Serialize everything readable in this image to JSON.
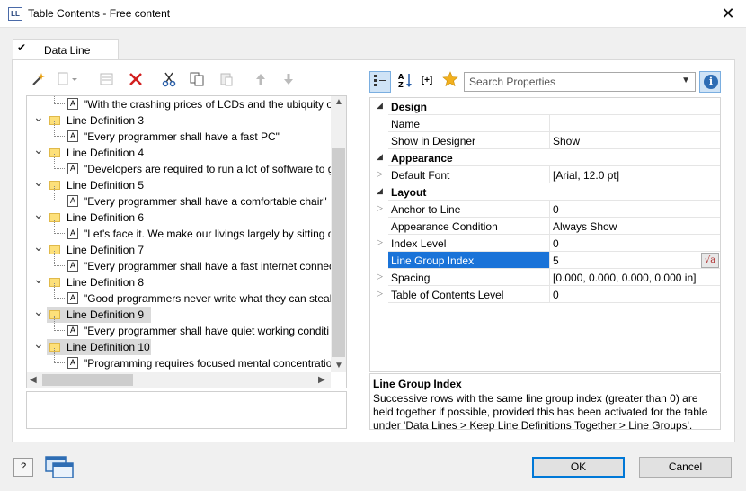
{
  "window": {
    "icon_label": "LL",
    "title": "Table Contents - Free content",
    "close_glyph": "✕"
  },
  "tabs": [
    {
      "label": "Data Line",
      "check": "✔"
    }
  ],
  "left_toolbar": {
    "items": [
      {
        "icon": "magic-wand-icon",
        "enabled": true
      },
      {
        "icon": "new-item-icon",
        "enabled": false
      },
      {
        "icon": "properties-icon",
        "enabled": false
      },
      {
        "icon": "delete-icon",
        "enabled": true
      },
      {
        "icon": "cut-icon",
        "enabled": true
      },
      {
        "icon": "copy-icon",
        "enabled": true
      },
      {
        "icon": "paste-icon",
        "enabled": false
      },
      {
        "icon": "move-up-icon",
        "enabled": false
      },
      {
        "icon": "move-down-icon",
        "enabled": false
      }
    ]
  },
  "tree": {
    "rows": [
      {
        "type": "text",
        "label": "\"With the crashing prices of LCDs and the ubiquity o"
      },
      {
        "type": "line",
        "label": "Line Definition  3",
        "selected": false
      },
      {
        "type": "text",
        "label": "\"Every programmer shall have a fast PC\""
      },
      {
        "type": "line",
        "label": "Line Definition  4",
        "selected": false
      },
      {
        "type": "text",
        "label": "\"Developers are required to run a lot of software to g"
      },
      {
        "type": "line",
        "label": "Line Definition  5",
        "selected": false
      },
      {
        "type": "text",
        "label": "\"Every programmer shall have a comfortable chair\""
      },
      {
        "type": "line",
        "label": "Line Definition  6",
        "selected": false
      },
      {
        "type": "text",
        "label": "\"Let's face it. We make our livings largely by sitting o"
      },
      {
        "type": "line",
        "label": "Line Definition  7",
        "selected": false
      },
      {
        "type": "text",
        "label": "\"Every programmer shall have a fast internet connec"
      },
      {
        "type": "line",
        "label": "Line Definition  8",
        "selected": false
      },
      {
        "type": "text",
        "label": "\"Good programmers never write what they can steal"
      },
      {
        "type": "line",
        "label": "Line Definition  9",
        "selected": true
      },
      {
        "type": "text",
        "label": "\"Every programmer shall have quiet working conditi"
      },
      {
        "type": "line",
        "label": "Line Definition 10",
        "selected": true
      },
      {
        "type": "text",
        "label": "\"Programming requires focused mental concentratio"
      }
    ]
  },
  "properties": {
    "search_placeholder": "Search Properties",
    "rows": [
      {
        "kind": "category",
        "name": "Design"
      },
      {
        "kind": "prop",
        "name": "Name",
        "value": "",
        "expandable": false
      },
      {
        "kind": "prop",
        "name": "Show in Designer",
        "value": "Show",
        "expandable": false
      },
      {
        "kind": "category",
        "name": "Appearance"
      },
      {
        "kind": "prop",
        "name": "Default Font",
        "value": "[Arial, 12.0 pt]",
        "expandable": true
      },
      {
        "kind": "category",
        "name": "Layout"
      },
      {
        "kind": "prop",
        "name": "Anchor to Line",
        "value": "0",
        "expandable": true
      },
      {
        "kind": "prop",
        "name": "Appearance Condition",
        "value": "Always Show",
        "expandable": false
      },
      {
        "kind": "prop",
        "name": "Index Level",
        "value": "0",
        "expandable": true
      },
      {
        "kind": "prop",
        "name": "Line Group Index",
        "value": "5",
        "expandable": false,
        "selected": true
      },
      {
        "kind": "prop",
        "name": "Spacing",
        "value": "[0.000, 0.000, 0.000, 0.000 in]",
        "expandable": true
      },
      {
        "kind": "prop",
        "name": "Table of Contents Level",
        "value": "0",
        "expandable": true
      }
    ],
    "formula_glyph": "√a"
  },
  "description": {
    "title": "Line Group Index",
    "text": "Successive rows with the same line group index (greater than 0) are held together if possible, provided this has been activated for the table under 'Data Lines > Keep Line Definitions Together > Line Groups'."
  },
  "footer": {
    "help_glyph": "?",
    "ok_label": "OK",
    "cancel_label": "Cancel"
  },
  "colors": {
    "selection": "#1a73d8",
    "folder": "#fde07a",
    "delete_red": "#d21e1e"
  }
}
